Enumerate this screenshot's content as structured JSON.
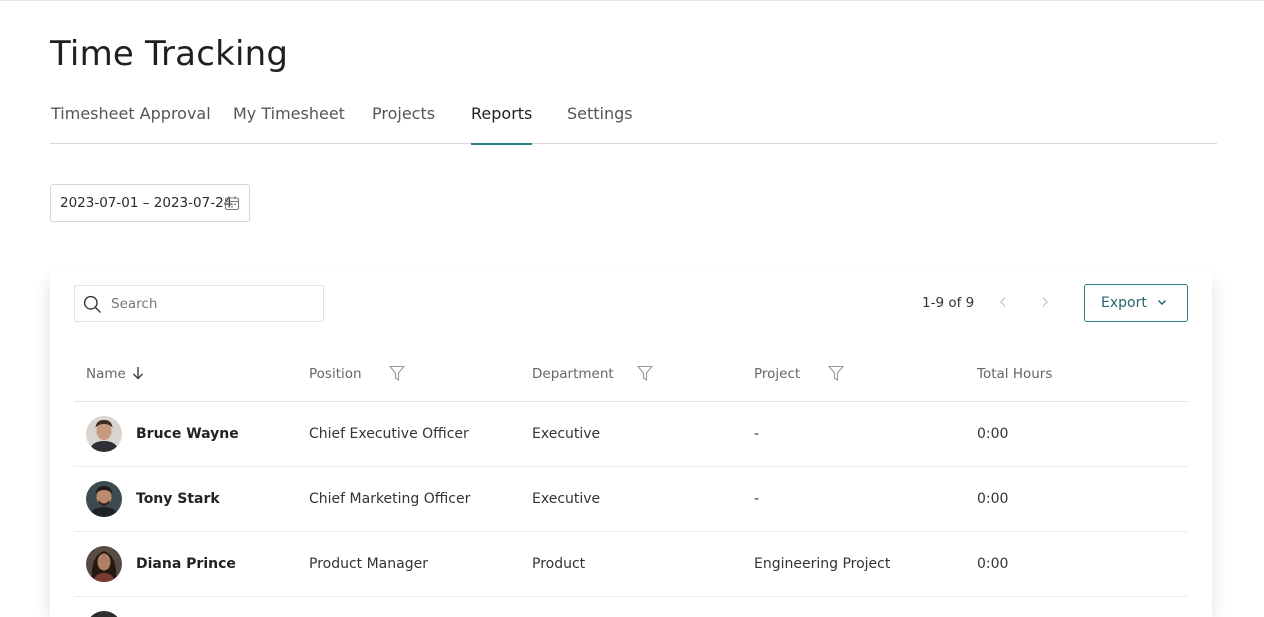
{
  "page": {
    "title": "Time Tracking"
  },
  "tabs": [
    {
      "label": "Timesheet Approval",
      "active": false
    },
    {
      "label": "My Timesheet",
      "active": false
    },
    {
      "label": "Projects",
      "active": false
    },
    {
      "label": "Reports",
      "active": true
    },
    {
      "label": "Settings",
      "active": false
    }
  ],
  "date_range": {
    "value": "2023-07-01 – 2023-07-24",
    "icon": "calendar-icon"
  },
  "search": {
    "placeholder": "Search",
    "icon": "search-icon"
  },
  "pagination": {
    "label": "1-9 of 9"
  },
  "export": {
    "label": "Export",
    "icon": "chevron-down-icon"
  },
  "colors": {
    "accent": "#2e7d88"
  },
  "table": {
    "columns": {
      "name": "Name",
      "position": "Position",
      "department": "Department",
      "project": "Project",
      "total_hours": "Total Hours"
    },
    "rows": [
      {
        "name": "Bruce Wayne",
        "position": "Chief Executive Officer",
        "department": "Executive",
        "project": "-",
        "total_hours": "0:00"
      },
      {
        "name": "Tony Stark",
        "position": "Chief Marketing Officer",
        "department": "Executive",
        "project": "-",
        "total_hours": "0:00"
      },
      {
        "name": "Diana Prince",
        "position": "Product Manager",
        "department": "Product",
        "project": "Engineering Project",
        "total_hours": "0:00"
      }
    ]
  }
}
